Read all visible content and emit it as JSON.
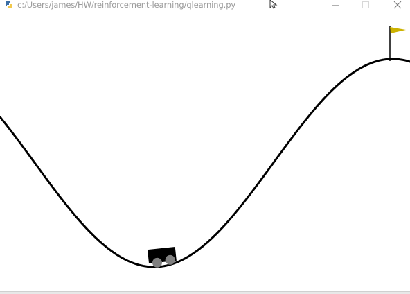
{
  "window": {
    "title": "c:/Users/james/HW/reinforcement-learning/qlearning.py"
  },
  "icons": {
    "app": "python-icon",
    "minimize": "minimize-icon",
    "maximize": "maximize-icon",
    "close": "close-icon",
    "cursor": "mouse-cursor-icon"
  },
  "colors": {
    "track": "#000000",
    "cart_body": "#000000",
    "wheels": "#808080",
    "flag": "#ccb200",
    "flagpole": "#000000",
    "background": "#ffffff"
  },
  "environment": {
    "name": "MountainCar"
  }
}
